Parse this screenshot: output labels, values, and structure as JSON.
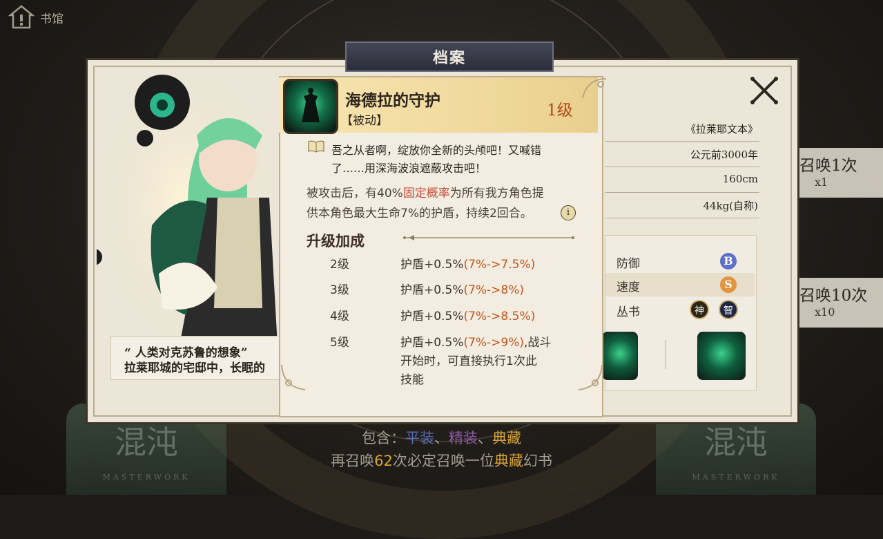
{
  "topbar": {
    "label": "书馆"
  },
  "panel": {
    "title": "档案"
  },
  "skill": {
    "name": "海德拉的守护",
    "type": "【被动】",
    "level": "1级",
    "flavor_line1": "吾之从者啊，绽放你全新的头颅吧！又喊错",
    "flavor_line2": "了……用深海波浪遮蔽攻击吧！",
    "desc_line1_a": "被攻击后，有40%",
    "desc_line1_hl": "固定概率",
    "desc_line1_b": "为所有我方角色提",
    "desc_line2": "供本角色最大生命7%的护盾，持续2回合。",
    "info_symbol": "i",
    "upgrade_title": "升级加成",
    "upgrades": [
      {
        "level": "2级",
        "base": "护盾+0.5%",
        "delta": "(7%->7.5%)",
        "extra": ""
      },
      {
        "level": "3级",
        "base": "护盾+0.5%",
        "delta": "(7%->8%)",
        "extra": ""
      },
      {
        "level": "4级",
        "base": "护盾+0.5%",
        "delta": "(7%->8.5%)",
        "extra": ""
      },
      {
        "level": "5级",
        "base": "护盾+0.5%",
        "delta": "(7%->9%)",
        "extra": ",战斗",
        "extra2": "开始时，可直接执行1次此",
        "extra3": "技能"
      }
    ]
  },
  "quote": {
    "line1": "“ 人类对克苏鲁的想象”",
    "line2": "拉莱耶城的宅邸中，长眠的"
  },
  "profile": {
    "rows": [
      "《拉莱耶文本》",
      "公元前3000年",
      "160cm",
      "44kg(自称)"
    ]
  },
  "stats": {
    "defense_label": "防御",
    "defense_grade": "B",
    "speed_label": "速度",
    "speed_grade": "S",
    "series_label": "丛书",
    "series_tag1": "神",
    "series_tag2": "智"
  },
  "summon": {
    "once_label": "召唤1次",
    "once_cost": "x1",
    "ten_label": "召唤10次",
    "ten_cost": "x10"
  },
  "banner": {
    "chaos_text": "混沌",
    "masterwork": "MASTERWORK",
    "contains_prefix": "包含：",
    "contains_1": "平装",
    "contains_sep": "、",
    "contains_2": "精装",
    "contains_3": "典藏",
    "pity_a": "再召唤",
    "pity_num": "62",
    "pity_b": "次必定召唤一位",
    "pity_hl": "典藏",
    "pity_c": "幻书"
  },
  "colors": {
    "accent_orange": "#c2571c",
    "level_red": "#b04a17",
    "highlight_red": "#c84c3a",
    "paperback_blue": "#5a6bb0",
    "hardcover_purple": "#8d5aa6",
    "collection_gold": "#d6a438"
  },
  "icons": [
    "home-icon",
    "close-icon",
    "book-icon",
    "info-icon"
  ]
}
